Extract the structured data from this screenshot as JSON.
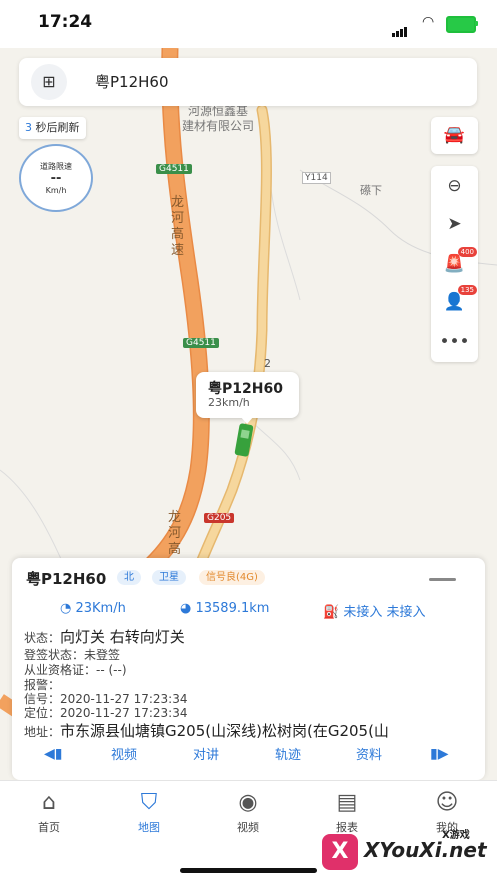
{
  "status_bar": {
    "time": "17:24"
  },
  "search": {
    "plate": "粤P12H60"
  },
  "map": {
    "refresh_count": "3",
    "refresh_text": "秒后刷新",
    "speed_limit": {
      "title": "道路限速",
      "value": "--",
      "unit": "Km/h"
    },
    "labels": {
      "company": "河源恒鑫基\n建材有限公司",
      "g4511_a": "G4511",
      "g4511_b": "G4511",
      "y114": "Y114",
      "place": "礤下",
      "expressway": "龙\n河\n高\n速",
      "expressway2": "龙\n河\n高",
      "g205": "G205",
      "road2": "2"
    },
    "toolbar": {
      "alarm_badge": "400",
      "person_badge": "135"
    },
    "vehicle": {
      "plate": "粤P12H60",
      "speed": "23km/h"
    }
  },
  "card": {
    "plate": "粤P12H60",
    "tags": {
      "direction": "北",
      "position": "卫星",
      "signal": "信号良(4G)"
    },
    "speed": "23Km/h",
    "mileage": "13589.1km",
    "fuel": "未接入 未接入",
    "state_label": "状态：",
    "state_value": "向灯关 右转向灯关",
    "signin_label": "登签状态：",
    "signin_value": "未登签",
    "qual_label": "从业资格证：",
    "qual_value": "-- (--)",
    "alarm_label": "报警：",
    "alarm_value": "",
    "signal_label": "信号：",
    "signal_value": "2020-11-27 17:23:34",
    "loc_label": "定位：",
    "loc_value": "2020-11-27 17:23:34",
    "addr_label": "地址：",
    "addr_value": "市东源县仙塘镇G205(山深线)松树岗(在G205(山",
    "actions": [
      "视频",
      "对讲",
      "轨迹",
      "资料"
    ]
  },
  "tabs": [
    {
      "label": "首页",
      "icon": "home-icon"
    },
    {
      "label": "地图",
      "icon": "map-icon"
    },
    {
      "label": "视频",
      "icon": "camera-icon"
    },
    {
      "label": "报表",
      "icon": "report-icon"
    },
    {
      "label": "我的",
      "icon": "user-icon"
    }
  ],
  "watermark": {
    "logo": "X",
    "text": "XYouXi.net",
    "sub": "X游戏"
  },
  "colors": {
    "accent": "#2d79d8",
    "highway": "#f2a15e",
    "road": "#f3cf8d",
    "alarm": "#e8423b"
  }
}
